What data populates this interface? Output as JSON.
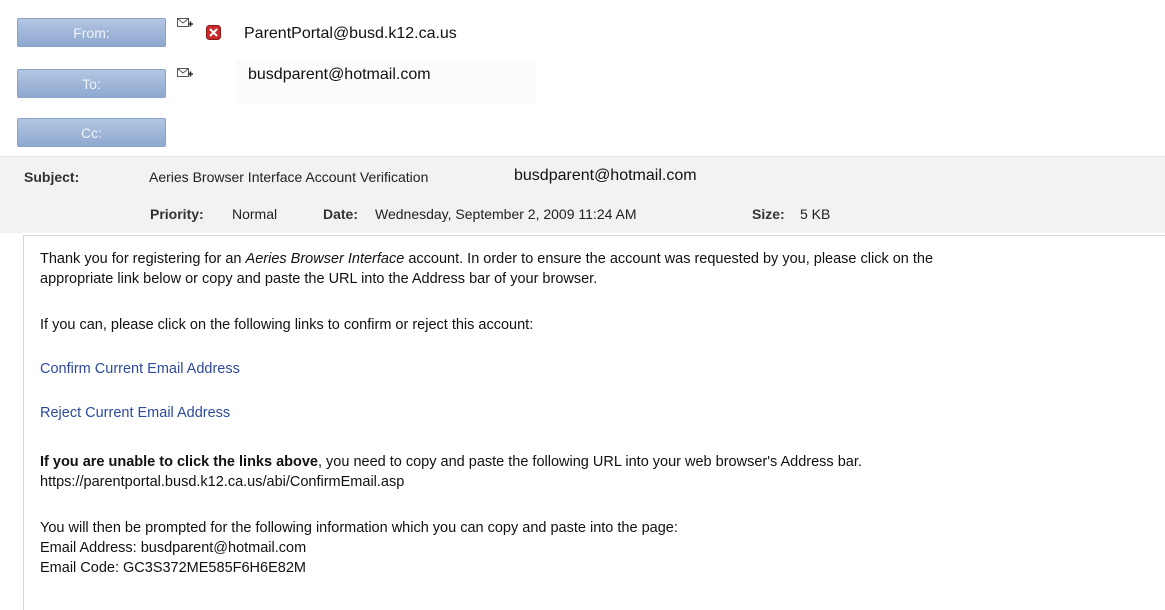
{
  "header": {
    "from_label": "From:",
    "to_label": "To:",
    "cc_label": "Cc:",
    "from_address": "ParentPortal@busd.k12.ca.us",
    "to_address": "busdparent@hotmail.com",
    "subject_label": "Subject:",
    "subject_text": "Aeries Browser Interface Account Verification",
    "subject_email": "busdparent@hotmail.com",
    "priority_label": "Priority:",
    "priority_value": "Normal",
    "date_label": "Date:",
    "date_value": "Wednesday, September 2, 2009 11:24 AM",
    "size_label": "Size:",
    "size_value": "5 KB"
  },
  "body": {
    "p1_pre": "Thank you for registering for an ",
    "p1_italic": "Aeries Browser Interface",
    "p1_post": " account. In order to ensure the account was requested by you, please click on the",
    "p1_line2": "appropriate link below or copy and paste the URL into the Address bar of your browser.",
    "p2": "If you can, please click on the following links to confirm or reject this account:",
    "confirm_link": "Confirm Current Email Address",
    "reject_link": "Reject Current Email Address",
    "p3_bold": "If you are unable to click the links above",
    "p3_rest": ", you need to copy and paste the following URL into your web browser's Address bar.",
    "url": "https://parentportal.busd.k12.ca.us/abi/ConfirmEmail.asp",
    "p4": "You will then be prompted for the following information which you can copy and paste into the page:",
    "email_line": "Email Address: busdparent@hotmail.com",
    "code_line": "Email Code: GC3S372ME585F6H6E82M"
  },
  "colors": {
    "accent": "#8ea8cf",
    "link": "#2d4a9c",
    "close_icon": "#cc2a2a"
  }
}
